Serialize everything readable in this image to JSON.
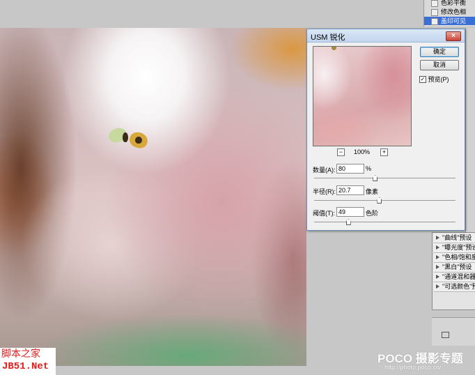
{
  "layers_panel": {
    "rows": [
      {
        "label": "色彩平衡",
        "selected": false
      },
      {
        "label": "修改色相",
        "selected": false
      },
      {
        "label": "盖印可见",
        "selected": true
      }
    ]
  },
  "dialog": {
    "title": "USM 锐化",
    "close_label": "×",
    "ok_label": "确定",
    "cancel_label": "取消",
    "preview_label": "预览(P)",
    "preview_checked": true,
    "preview_checkmark": "✓",
    "zoom": {
      "minus": "−",
      "value": "100%",
      "plus": "+"
    },
    "params": [
      {
        "label": "数量(A):",
        "value": "80",
        "unit": "%",
        "slider": 0.43
      },
      {
        "label": "半径(R):",
        "value": "20.7",
        "unit": "像素",
        "slider": 0.46
      },
      {
        "label": "阈值(T):",
        "value": "49",
        "unit": "色阶",
        "slider": 0.24
      }
    ]
  },
  "presets_panel": {
    "items": [
      "\"曲线\"预设",
      "\"曝光度\"预设",
      "\"色相/饱和度\"预设",
      "\"黑白\"预设",
      "\"通道混和器\"预设",
      "\"可选颜色\"预设"
    ]
  },
  "watermark_left": {
    "line1": "脚本之家",
    "line2": "JB51.Net"
  },
  "watermark_right": {
    "line1": "POCO 摄影专题",
    "line2": "http://photo.poco.cn/"
  }
}
